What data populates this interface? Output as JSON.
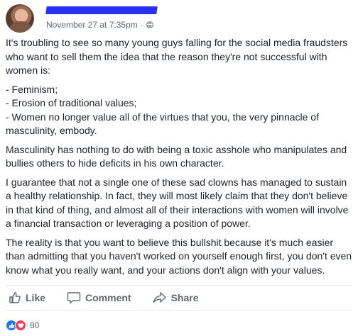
{
  "post": {
    "timestamp": "November 27 at 7:35pm",
    "separator": "·",
    "privacy_icon": "globe-icon",
    "paragraphs": {
      "intro": "It's troubling to see so many young guys falling for the social media fraudsters who want to sell them the idea that the reason they're not successful with women is:",
      "list": [
        "- Feminism;",
        "- Erosion of traditional values;",
        "- Women no longer value all of the virtues that you, the very pinnacle of masculinity, embody."
      ],
      "p2": "Masculinity has nothing to do with being a toxic asshole who manipulates and bullies others to hide deficits in his own character.",
      "p3": "I guarantee that not a single one of these sad clowns has managed to sustain a healthy relationship. In fact, they will most likely claim that they don't believe in that kind of thing, and almost all of their interactions with women will involve a financial transaction or leveraging a position of power.",
      "p4": "The reality is that you want to believe this bullshit because it's much easier than admitting that you haven't worked on yourself enough first, you don't even know what you really want, and your actions don't align with your values."
    }
  },
  "actions": {
    "like_label": "Like",
    "comment_label": "Comment",
    "share_label": "Share"
  },
  "reactions": {
    "count": "80",
    "types": [
      "like-reaction-icon",
      "love-reaction-icon"
    ]
  },
  "colors": {
    "redaction": "#2a2ef2",
    "like_blue": "#1877f2",
    "love_red": "#f33e58",
    "meta_gray": "#616770"
  }
}
